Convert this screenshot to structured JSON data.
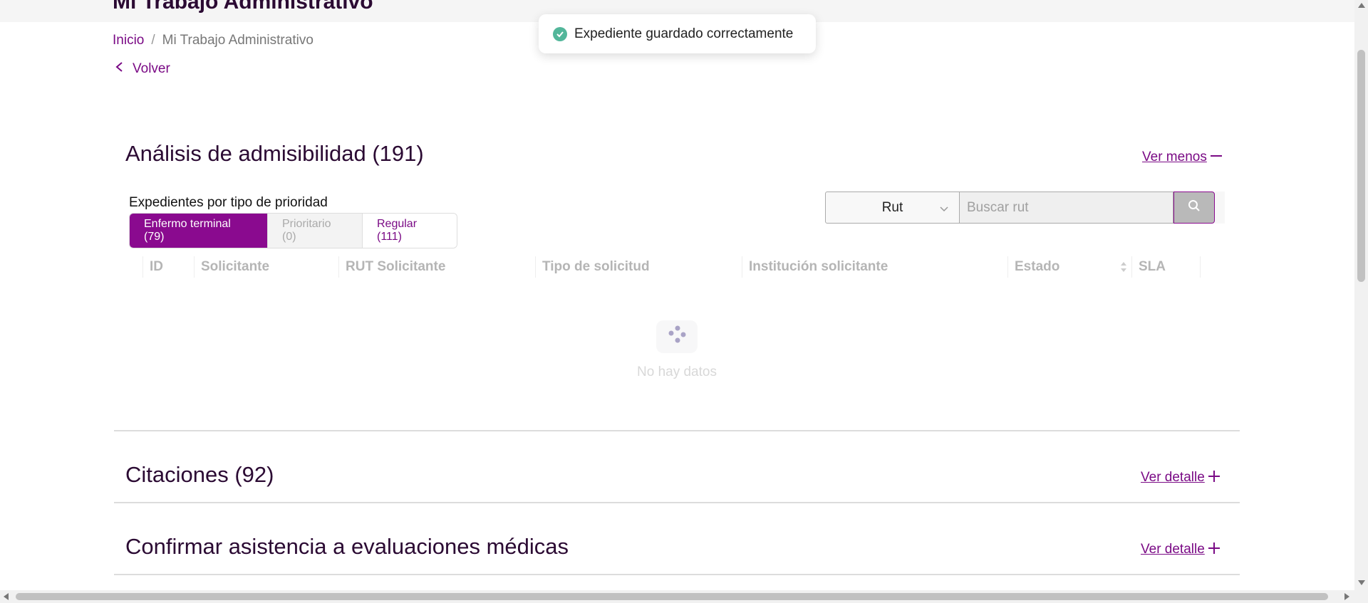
{
  "header": {
    "title": "Mi Trabajo Administrativo"
  },
  "breadcrumb": {
    "home": "Inicio",
    "separator": "/",
    "current": "Mi Trabajo Administrativo"
  },
  "back": {
    "label": "Volver"
  },
  "toast": {
    "message": "Expediente guardado correctamente"
  },
  "sections": {
    "admisibilidad": {
      "title": "Análisis de admisibilidad (191)",
      "link": "Ver menos",
      "link_icon": "minus-icon"
    },
    "citaciones": {
      "title": "Citaciones (92)",
      "link": "Ver detalle",
      "link_icon": "plus-icon"
    },
    "confirmar": {
      "title": "Confirmar asistencia a evaluaciones médicas",
      "link": "Ver detalle",
      "link_icon": "plus-icon"
    }
  },
  "priority": {
    "label": "Expedientes por tipo de prioridad",
    "tabs": [
      {
        "label": "Enfermo terminal (79)",
        "state": "active"
      },
      {
        "label": "Prioritario (0)",
        "state": "disabled"
      },
      {
        "label": "Regular (111)",
        "state": "normal"
      }
    ]
  },
  "search": {
    "filter_value": "Rut",
    "placeholder": "Buscar rut"
  },
  "table": {
    "columns": [
      "ID",
      "Solicitante",
      "RUT Solicitante",
      "Tipo de solicitud",
      "Institución solicitante",
      "Estado",
      "SLA"
    ],
    "empty_text": "No hay datos"
  },
  "colors": {
    "brand": "#8a0a8f",
    "title": "#2b0a33",
    "success": "#52b69a"
  }
}
